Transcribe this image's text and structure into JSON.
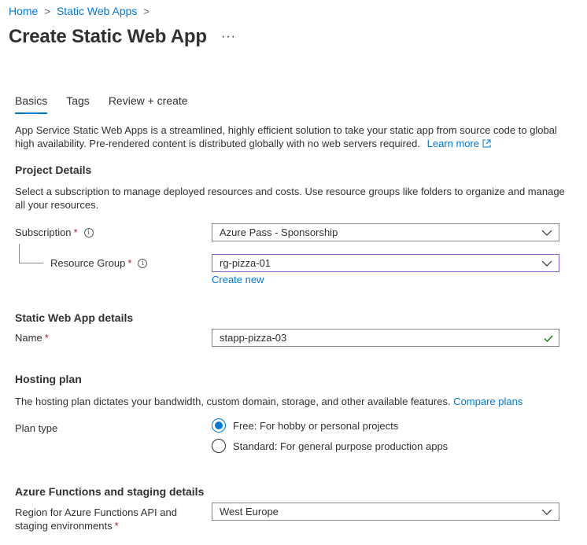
{
  "breadcrumb": {
    "items": [
      "Home",
      "Static Web Apps"
    ],
    "separator": ">"
  },
  "page": {
    "title": "Create Static Web App",
    "more_label": "···"
  },
  "tabs": [
    {
      "label": "Basics",
      "active": true
    },
    {
      "label": "Tags",
      "active": false
    },
    {
      "label": "Review + create",
      "active": false
    }
  ],
  "intro": {
    "text": "App Service Static Web Apps is a streamlined, highly efficient solution to take your static app from source code to global high availability. Pre-rendered content is distributed globally with no web servers required.",
    "link": "Learn more"
  },
  "project": {
    "heading": "Project Details",
    "description": "Select a subscription to manage deployed resources and costs. Use resource groups like folders to organize and manage all your resources.",
    "subscription_label": "Subscription",
    "subscription_value": "Azure Pass - Sponsorship",
    "resource_group_label": "Resource Group",
    "resource_group_value": "rg-pizza-01",
    "create_new": "Create new"
  },
  "details": {
    "heading": "Static Web App details",
    "name_label": "Name",
    "name_value": "stapp-pizza-03"
  },
  "hosting": {
    "heading": "Hosting plan",
    "description": "The hosting plan dictates your bandwidth, custom domain, storage, and other available features.",
    "compare_link": "Compare plans",
    "plan_type_label": "Plan type",
    "options": [
      {
        "label": "Free: For hobby or personal projects",
        "selected": true
      },
      {
        "label": "Standard: For general purpose production apps",
        "selected": false
      }
    ]
  },
  "functions": {
    "heading": "Azure Functions and staging details",
    "region_label_line1": "Region for Azure Functions API and",
    "region_label_line2": "staging environments",
    "region_value": "West Europe"
  },
  "required_mark": "*",
  "info_icon_glyph": "i",
  "colors": {
    "accent": "#0078d4",
    "required": "#a4262c",
    "valid": "#107c10",
    "focus_border": "#8661c5"
  }
}
